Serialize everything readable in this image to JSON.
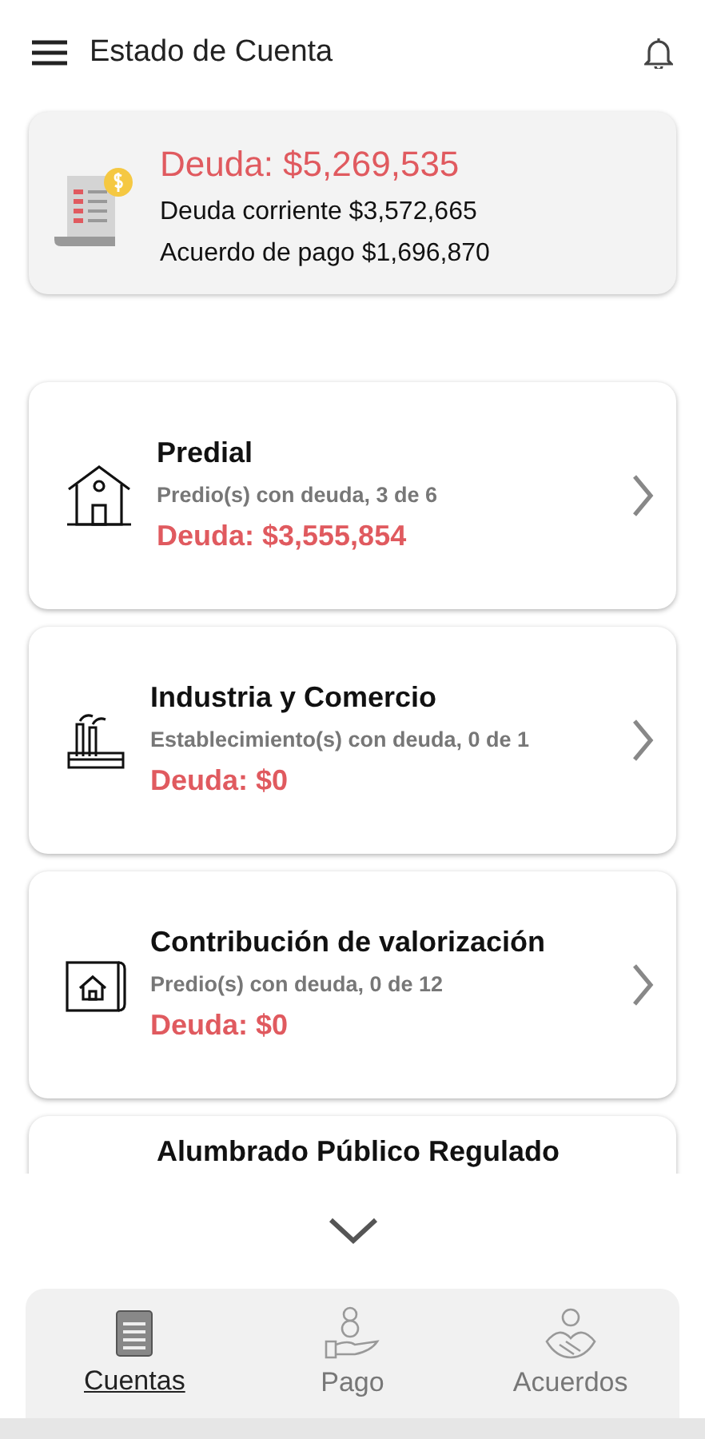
{
  "header": {
    "title": "Estado de Cuenta"
  },
  "summary": {
    "total": "Deuda: $5,269,535",
    "lines": [
      "Deuda corriente $3,572,665",
      "Acuerdo de pago $1,696,870"
    ]
  },
  "accounts": [
    {
      "kind": "house",
      "title": "Predial",
      "subtitle": "Predio(s) con deuda, 3 de 6",
      "debt": "Deuda: $3,555,854"
    },
    {
      "kind": "factory",
      "title": "Industria y Comercio",
      "subtitle": "Establecimiento(s) con deuda, 0 de 1",
      "debt": "Deuda: $0"
    },
    {
      "kind": "plan",
      "title": "Contribución de valorización",
      "subtitle": "Predio(s) con deuda, 0 de 12",
      "debt": "Deuda: $0"
    },
    {
      "kind": "partial",
      "title": "Alumbrado Público Regulado"
    }
  ],
  "tabs": [
    {
      "kind": "accounts",
      "label": "Cuentas",
      "selected": true
    },
    {
      "kind": "payment",
      "label": "Pago",
      "selected": false
    },
    {
      "kind": "agreements",
      "label": "Acuerdos",
      "selected": false
    }
  ]
}
